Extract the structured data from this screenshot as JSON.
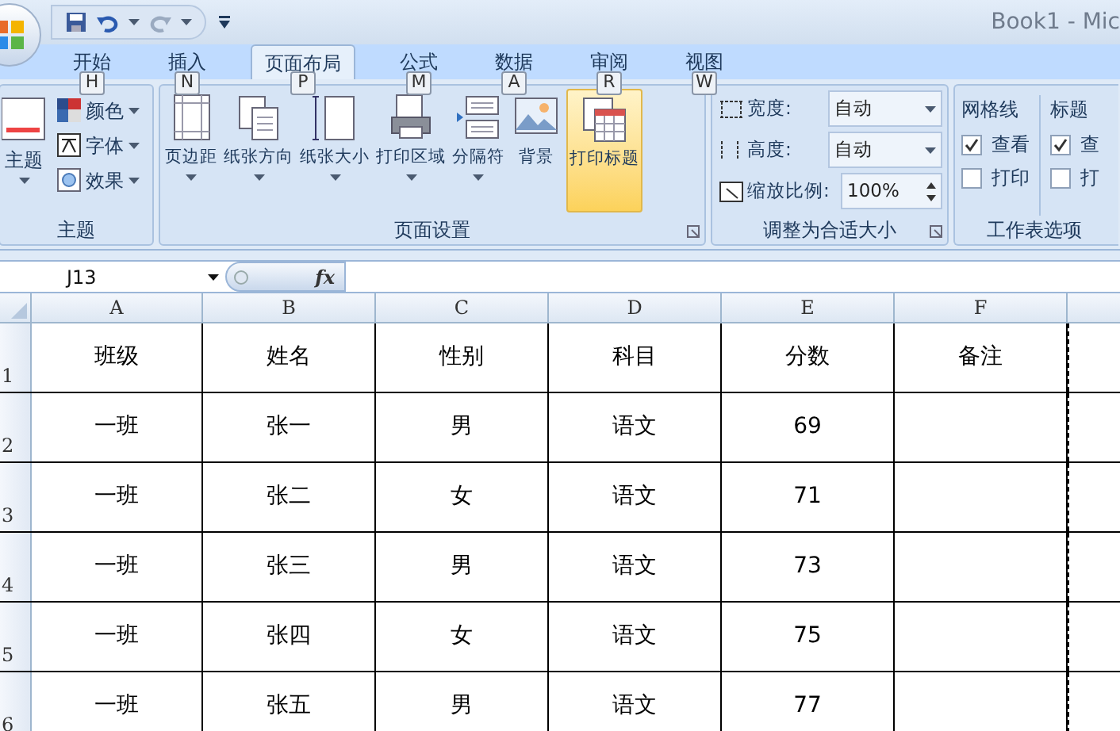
{
  "title_bar": {
    "title": "Book1 - Mic"
  },
  "tabs": [
    {
      "label": "开始",
      "keytip": "H",
      "selected": false
    },
    {
      "label": "插入",
      "keytip": "N",
      "selected": false
    },
    {
      "label": "页面布局",
      "keytip": "P",
      "selected": true
    },
    {
      "label": "公式",
      "keytip": "M",
      "selected": false
    },
    {
      "label": "数据",
      "keytip": "A",
      "selected": false
    },
    {
      "label": "审阅",
      "keytip": "R",
      "selected": false
    },
    {
      "label": "视图",
      "keytip": "W",
      "selected": false
    }
  ],
  "theme_group": {
    "label": "主题",
    "big_button": "主题",
    "small_buttons": [
      "颜色",
      "字体",
      "效果"
    ]
  },
  "page_setup_group": {
    "label": "页面设置",
    "buttons": [
      {
        "label": "页边距",
        "dropdown": true,
        "selected": false
      },
      {
        "label": "纸张方向",
        "dropdown": true,
        "selected": false
      },
      {
        "label": "纸张大小",
        "dropdown": true,
        "selected": false
      },
      {
        "label": "打印区域",
        "dropdown": true,
        "selected": false
      },
      {
        "label": "分隔符",
        "dropdown": true,
        "selected": false
      },
      {
        "label": "背景",
        "dropdown": false,
        "selected": false
      },
      {
        "label": "打印标题",
        "dropdown": false,
        "selected": true
      }
    ]
  },
  "scale_group": {
    "label": "调整为合适大小",
    "width_label": "宽度:",
    "width_value": "自动",
    "height_label": "高度:",
    "height_value": "自动",
    "scale_label": "缩放比例:",
    "scale_value": "100%"
  },
  "sheet_options_group": {
    "label": "工作表选项",
    "gridlines": {
      "label": "网格线",
      "view": {
        "label": "查看",
        "checked": true
      },
      "print": {
        "label": "打印",
        "checked": false
      }
    },
    "headings": {
      "label": "标题",
      "view": {
        "label": "查",
        "checked": true
      },
      "print": {
        "label": "打",
        "checked": false
      }
    }
  },
  "formula_bar": {
    "name_box": "J13",
    "fx": "fx"
  },
  "sheet": {
    "columns": [
      "A",
      "B",
      "C",
      "D",
      "E",
      "F"
    ],
    "rows": [
      {
        "number": "1",
        "cells": [
          "班级",
          "姓名",
          "性别",
          "科目",
          "分数",
          "备注"
        ]
      },
      {
        "number": "2",
        "cells": [
          "一班",
          "张一",
          "男",
          "语文",
          "69",
          ""
        ]
      },
      {
        "number": "3",
        "cells": [
          "一班",
          "张二",
          "女",
          "语文",
          "71",
          ""
        ]
      },
      {
        "number": "4",
        "cells": [
          "一班",
          "张三",
          "男",
          "语文",
          "73",
          ""
        ]
      },
      {
        "number": "5",
        "cells": [
          "一班",
          "张四",
          "女",
          "语文",
          "75",
          ""
        ]
      },
      {
        "number": "6",
        "cells": [
          "一班",
          "张五",
          "男",
          "语文",
          "77",
          ""
        ]
      }
    ]
  }
}
